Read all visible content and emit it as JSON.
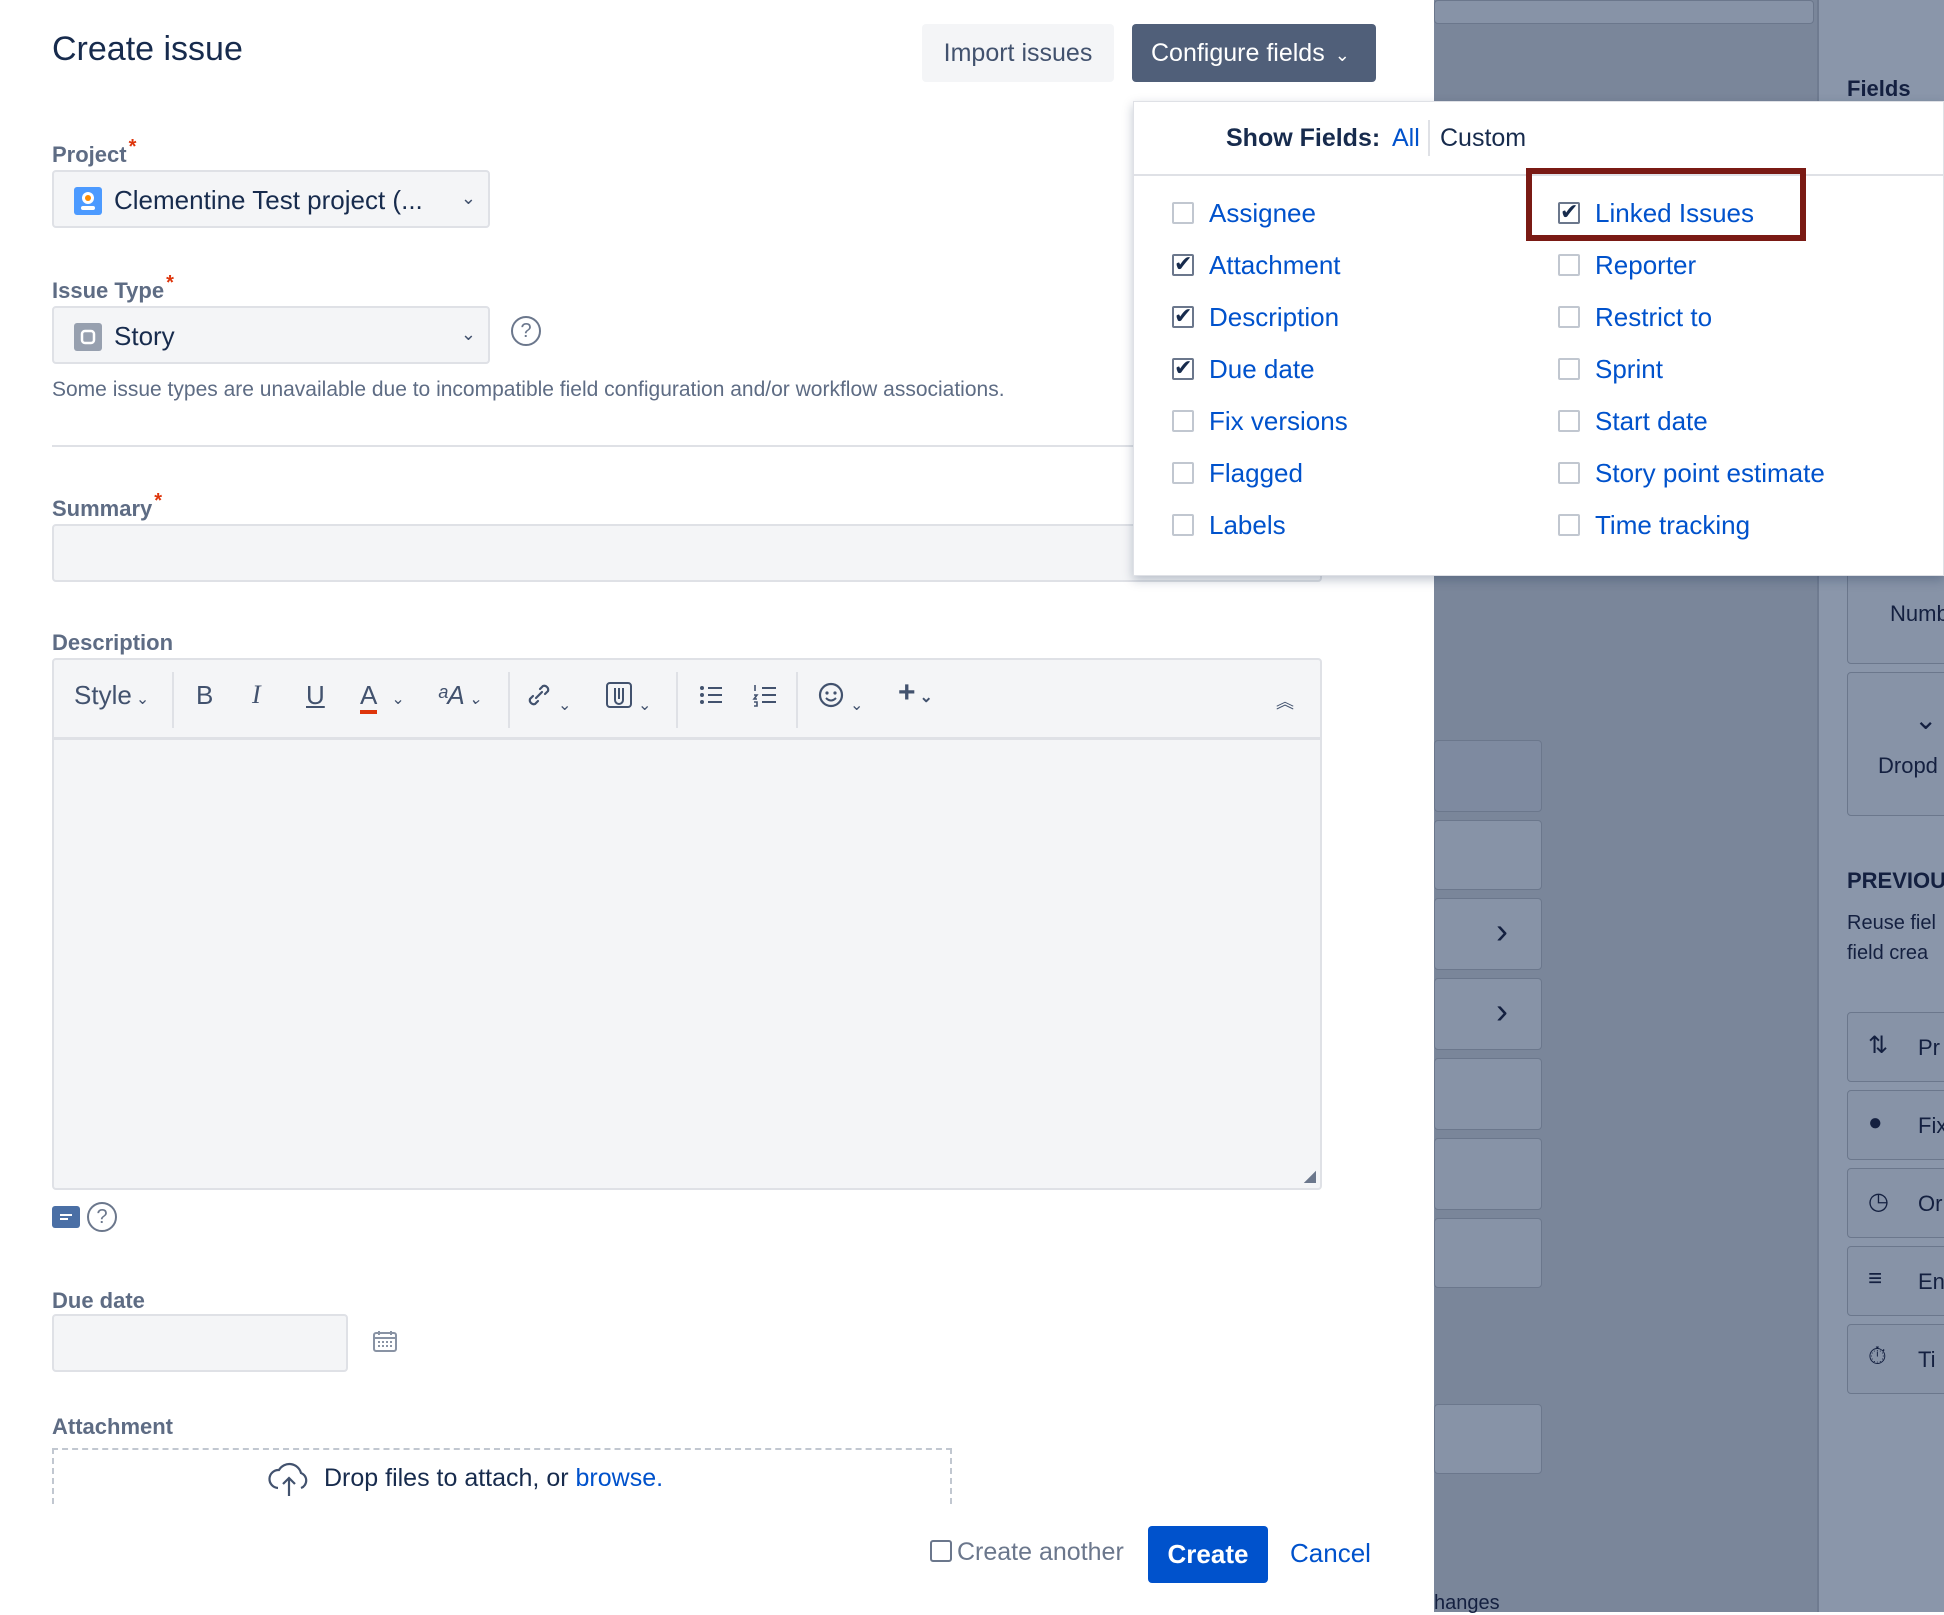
{
  "modal": {
    "title": "Create issue",
    "import_label": "Import issues",
    "configure_label": "Configure fields",
    "project": {
      "label": "Project",
      "required": "*",
      "value": "Clementine Test project (..."
    },
    "issue_type": {
      "label": "Issue Type",
      "required": "*",
      "value": "Story",
      "help": "?",
      "hint": "Some issue types are unavailable due to incompatible field configuration and/or workflow associations."
    },
    "summary": {
      "label": "Summary",
      "required": "*",
      "value": ""
    },
    "description": {
      "label": "Description",
      "toolbar": {
        "style": "Style",
        "bold": "B",
        "italic": "I",
        "underline": "U",
        "color": "A",
        "size": "ᵃA",
        "plus": "+"
      },
      "help": "?"
    },
    "due_date": {
      "label": "Due date",
      "value": ""
    },
    "attachment": {
      "label": "Attachment",
      "drop_text": "Drop files to attach, or ",
      "browse": "browse."
    },
    "footer": {
      "create_another": "Create another",
      "create": "Create",
      "cancel": "Cancel"
    }
  },
  "popup": {
    "show_fields_label": "Show Fields:",
    "all": "All",
    "custom": "Custom",
    "fields_left": [
      {
        "name": "Assignee",
        "checked": false
      },
      {
        "name": "Attachment",
        "checked": true
      },
      {
        "name": "Description",
        "checked": true
      },
      {
        "name": "Due date",
        "checked": true
      },
      {
        "name": "Fix versions",
        "checked": false
      },
      {
        "name": "Flagged",
        "checked": false
      },
      {
        "name": "Labels",
        "checked": false
      }
    ],
    "fields_right": [
      {
        "name": "Linked Issues",
        "checked": true
      },
      {
        "name": "Reporter",
        "checked": false
      },
      {
        "name": "Restrict to",
        "checked": false
      },
      {
        "name": "Sprint",
        "checked": false
      },
      {
        "name": "Start date",
        "checked": false
      },
      {
        "name": "Story point estimate",
        "checked": false
      },
      {
        "name": "Time tracking",
        "checked": false
      }
    ]
  },
  "background": {
    "fields_heading": "Fields",
    "card_numb": "Numb",
    "card_dropd": "Dropd",
    "previous_heading": "PREVIOU",
    "previous_text_1": "Reuse fiel",
    "previous_text_2": "field crea",
    "list_items": [
      "Pr",
      "Fix",
      "Or",
      "En",
      "Ti"
    ],
    "bottom_text": "hanges"
  },
  "colors": {
    "primary": "#0052cc",
    "highlight_border": "#7a1a14",
    "overlay": "#7a869a"
  }
}
